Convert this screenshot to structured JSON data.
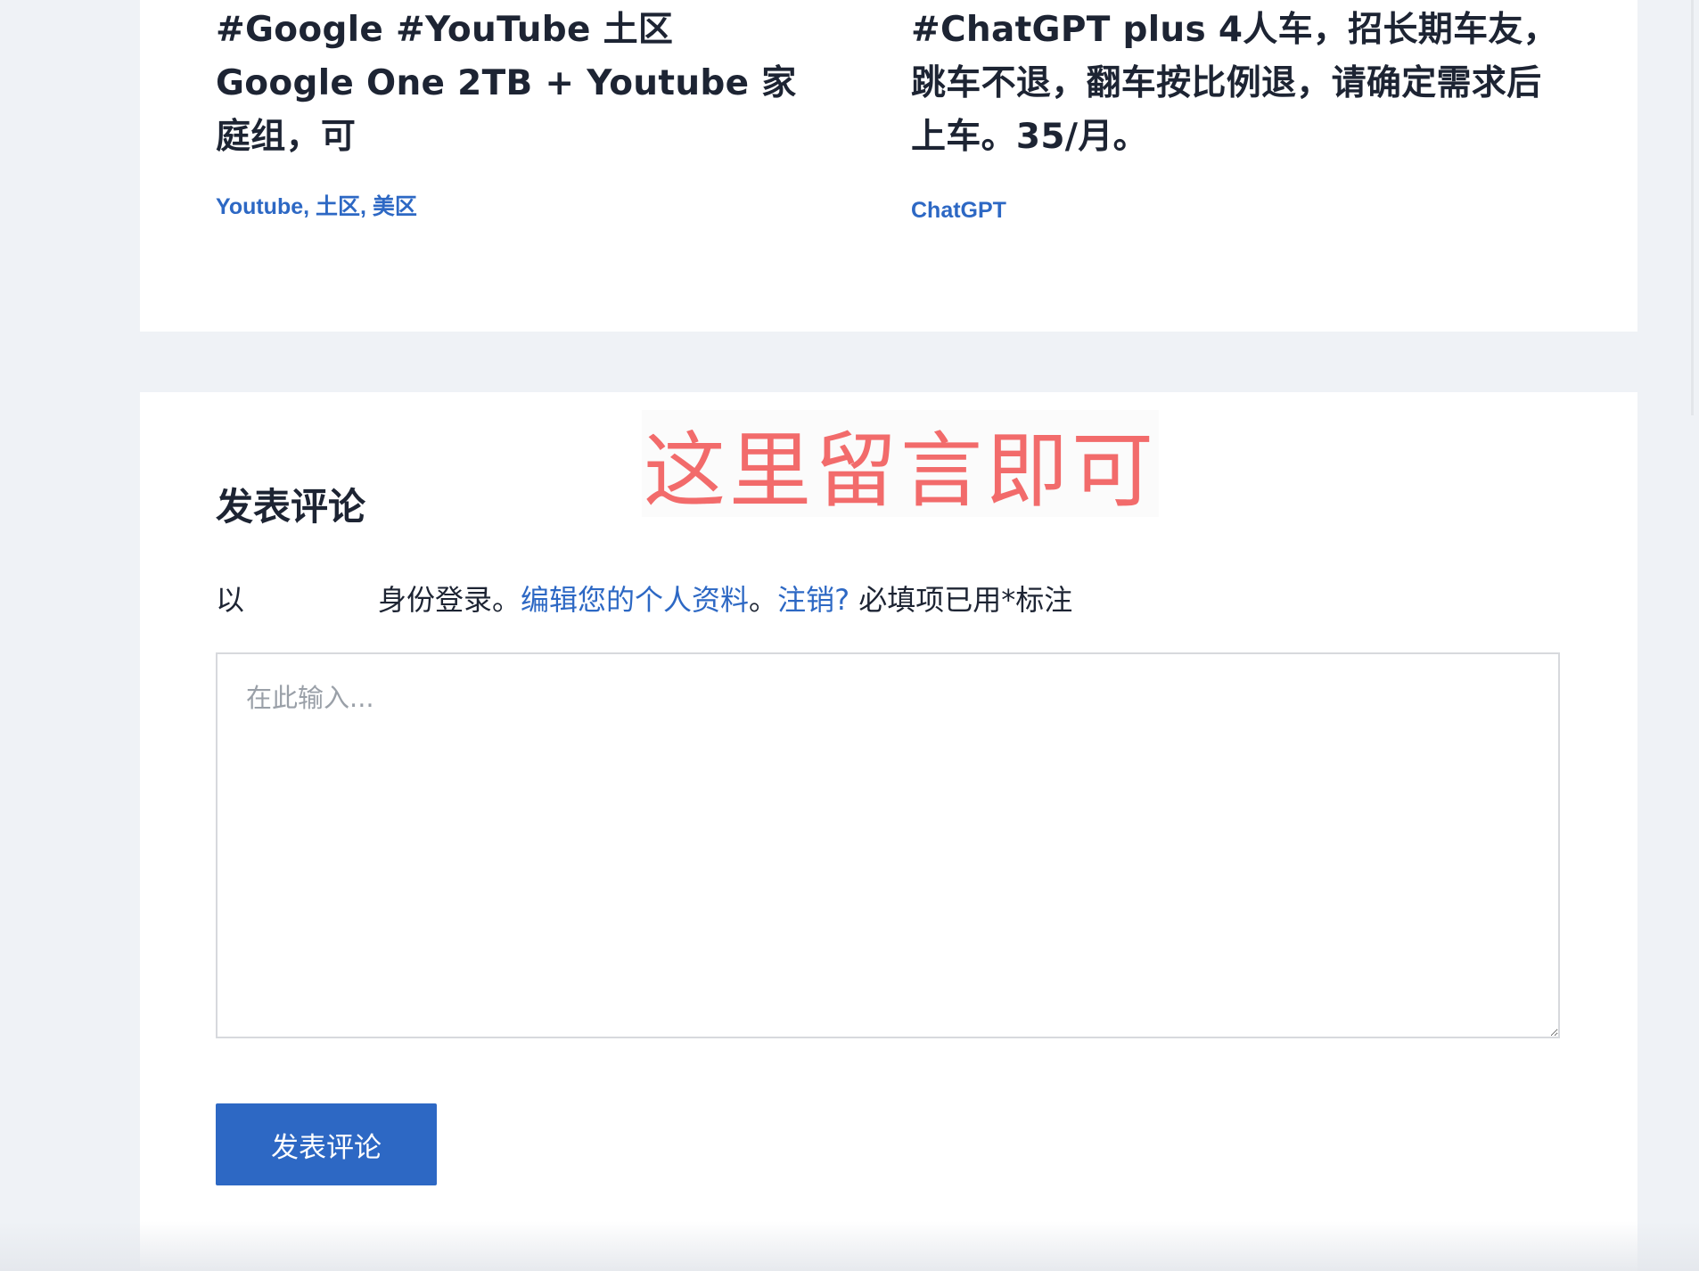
{
  "related_posts": [
    {
      "title": "#Google #YouTube 土区 Google One 2TB + Youtube 家庭组，可",
      "tags_text": "Youtube, 土区, 美区"
    },
    {
      "title": "#ChatGPT plus 4人车，招长期车友，跳车不退，翻车按比例退，请确定需求后上车。35/月。",
      "tags_text": "ChatGPT"
    }
  ],
  "overlay_note": "这里留言即可",
  "comment_form": {
    "heading": "发表评论",
    "login_prefix": "以",
    "login_suffix": "身份登录。",
    "edit_profile_link": "编辑您的个人资料",
    "separator": "。",
    "logout_link": "注销?",
    "required_note": "必填项已用*标注",
    "textarea_placeholder": "在此输入...",
    "submit_label": "发表评论"
  },
  "colors": {
    "accent": "#2d68c4",
    "note_red": "#f26b6b",
    "page_bg": "#eff2f6"
  }
}
